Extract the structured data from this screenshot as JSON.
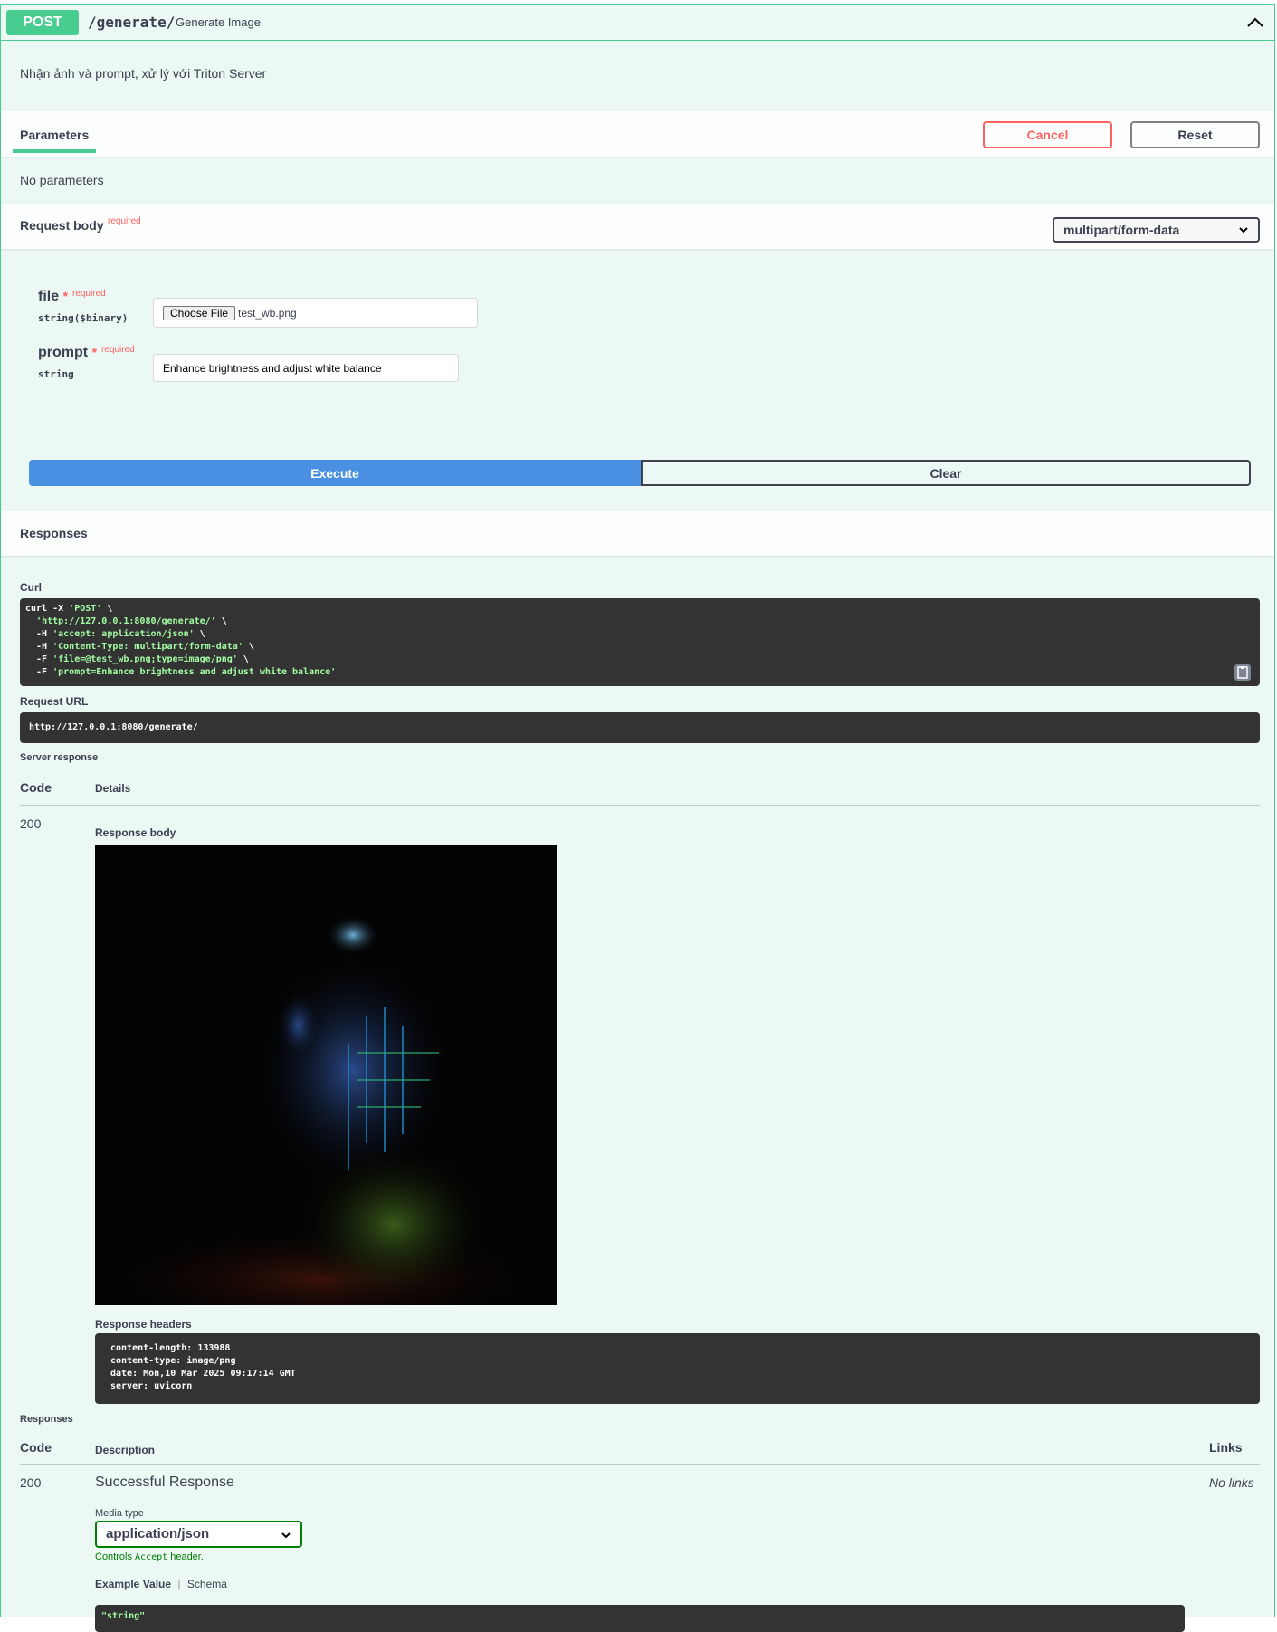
{
  "summary": {
    "method": "POST",
    "path": "/generate/",
    "description": "Generate Image"
  },
  "description": "Nhận ảnh và prompt, xử lý với Triton Server",
  "parameters_tab": "Parameters",
  "buttons": {
    "cancel": "Cancel",
    "reset": "Reset",
    "execute": "Execute",
    "clear": "Clear"
  },
  "no_parameters": "No parameters",
  "request_body": {
    "label": "Request body",
    "required": "required",
    "content_type": "multipart/form-data"
  },
  "fields": [
    {
      "name": "file",
      "star": "*",
      "required": "required",
      "type": "string($binary)",
      "choose_label": "Choose File",
      "file_name": "test_wb.png"
    },
    {
      "name": "prompt",
      "star": "*",
      "required": "required",
      "type": "string",
      "value": "Enhance brightness and adjust white balance"
    }
  ],
  "responses_title": "Responses",
  "curl": {
    "label": "Curl",
    "lines": [
      {
        "cmd": "curl -X ",
        "str": "'POST'",
        "tail": " \\"
      },
      {
        "cmd": "  ",
        "str": "'http://127.0.0.1:8080/generate/'",
        "tail": " \\"
      },
      {
        "cmd": "  -H ",
        "str": "'accept: application/json'",
        "tail": " \\"
      },
      {
        "cmd": "  -H ",
        "str": "'Content-Type: multipart/form-data'",
        "tail": " \\"
      },
      {
        "cmd": "  -F ",
        "str": "'file=@test_wb.png;type=image/png'",
        "tail": " \\"
      },
      {
        "cmd": "  -F ",
        "str": "'prompt=Enhance brightness and adjust white balance'",
        "tail": ""
      }
    ]
  },
  "request_url": {
    "label": "Request URL",
    "value": "http://127.0.0.1:8080/generate/"
  },
  "server_response": {
    "label": "Server response",
    "code_header": "Code",
    "details_header": "Details",
    "code": "200",
    "body_label": "Response body",
    "headers_label": "Response headers",
    "headers": [
      "content-length: 133988",
      "content-type: image/png",
      "date: Mon,10 Mar 2025 09:17:14 GMT",
      "server: uvicorn"
    ]
  },
  "responses_table": {
    "label": "Responses",
    "code_header": "Code",
    "description_header": "Description",
    "links_header": "Links",
    "code": "200",
    "description": "Successful Response",
    "links": "No links",
    "media_type_label": "Media type",
    "media_type": "application/json",
    "controls_pre": "Controls ",
    "controls_code": "Accept",
    "controls_post": " header.",
    "example_tab": "Example Value",
    "schema_tab": "Schema",
    "example_value": "\"string\""
  },
  "colors": {
    "post_green": "#49cc90",
    "background": "#ebf8f3",
    "execute_blue": "#4990e2",
    "cancel_red": "#ff6060",
    "code_bg": "#333333"
  }
}
